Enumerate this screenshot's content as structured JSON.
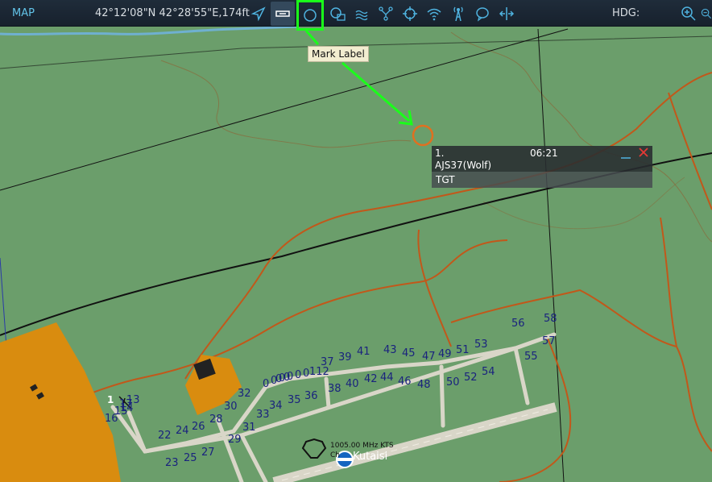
{
  "toolbar": {
    "map_label": "MAP",
    "coords": "42°12'08\"N 42°28'55\"E,174ft",
    "hdg_label": "HDG:"
  },
  "tooltip": {
    "text": "Mark Label"
  },
  "mark_panel": {
    "number": "1.",
    "time": "06:21",
    "name": "AJS37(Wolf)",
    "label": "TGT"
  },
  "airfield": {
    "freq_text": "1005.00 MHz KTS",
    "ch_text": "Ch",
    "name": "Kutaisi",
    "unit_num": "1"
  },
  "colors": {
    "map_bg": "#6b9e6b",
    "road": "#c2581a",
    "river": "#6fb0d0",
    "mark_circle": "#e07020",
    "highlight": "#1aff1a",
    "urban": "#d98c0f",
    "taxiway": "#d9d6c8",
    "parking_label": "#1a237e"
  },
  "parking_spots": [
    "13",
    "14",
    "15",
    "16",
    "17",
    "22",
    "23",
    "24",
    "25",
    "26",
    "27",
    "28",
    "29",
    "30",
    "31",
    "32",
    "33",
    "34",
    "35",
    "36",
    "37",
    "38",
    "39",
    "40",
    "41",
    "42",
    "43",
    "44",
    "45",
    "46",
    "47",
    "48",
    "49",
    "50",
    "51",
    "52",
    "53",
    "54",
    "55",
    "56",
    "57",
    "58",
    "112",
    "0",
    "0",
    "0",
    "0",
    "0",
    "0",
    "0",
    "0",
    "0"
  ]
}
